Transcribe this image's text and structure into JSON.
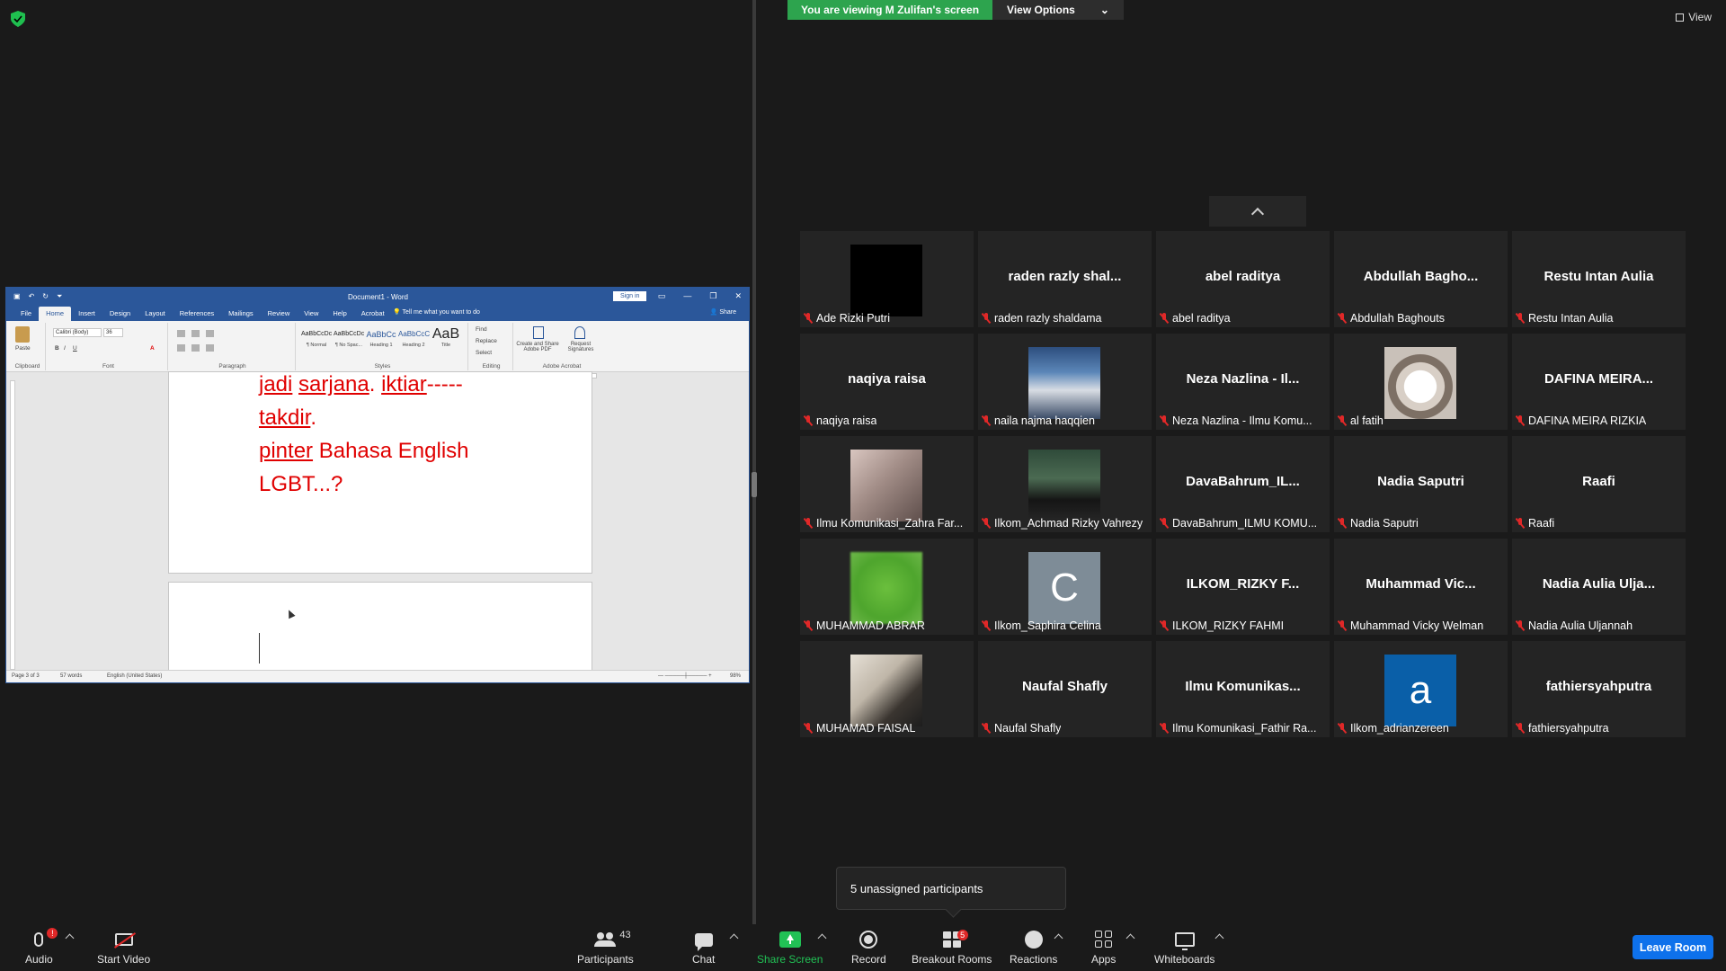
{
  "colors": {
    "accent": "#0e71eb",
    "green": "#2da44e",
    "muted_red": "#e02828",
    "word_blue": "#2b579a",
    "doc_text_red": "#e00000"
  },
  "banner": {
    "viewing": "You are viewing M Zulifan's screen",
    "view_options": "View Options"
  },
  "view_button": {
    "label": "View",
    "icon": "grid-view-icon"
  },
  "word": {
    "title": "Document1  -  Word",
    "sign_in": "Sign in",
    "tabs": [
      "File",
      "Home",
      "Insert",
      "Design",
      "Layout",
      "References",
      "Mailings",
      "Review",
      "View",
      "Help",
      "Acrobat"
    ],
    "tell_me": "Tell me what you want to do",
    "share": "Share",
    "ribbon": {
      "paste": "Paste",
      "font_name": "Calibri (Body)",
      "font_size": "36",
      "styles": [
        {
          "preview": "AaBbCcDc",
          "name": "¶ Normal"
        },
        {
          "preview": "AaBbCcDc",
          "name": "¶ No Spac..."
        },
        {
          "preview": "AaBbCc",
          "name": "Heading 1"
        },
        {
          "preview": "AaBbCcC",
          "name": "Heading 2"
        },
        {
          "preview": "AaB",
          "name": "Title"
        }
      ],
      "find": "Find",
      "replace": "Replace",
      "select": "Select",
      "create_pdf": "Create and Share Adobe PDF",
      "request_sig": "Request Signatures",
      "groups": {
        "clipboard": "Clipboard",
        "font": "Font",
        "paragraph": "Paragraph",
        "styles": "Styles",
        "editing": "Editing",
        "acrobat": "Adobe Acrobat"
      }
    },
    "document_lines": {
      "line1": {
        "a": "jadi",
        "b": "sarjana",
        "c": ". ",
        "d": "iktiar",
        "e": "-----"
      },
      "line2": {
        "a": "takdir",
        "b": "."
      },
      "line3": {
        "a": "pinter",
        "b": " Bahasa English"
      },
      "line4": "LGBT...?"
    },
    "status": {
      "page": "Page 3 of 3",
      "words": "57 words",
      "language": "English (United States)",
      "zoom": "98%"
    }
  },
  "participants_tiles": [
    {
      "big": "",
      "name": "Ade Rizki Putri",
      "avatar": "black"
    },
    {
      "big": "raden  razly  shal...",
      "name": "raden razly shaldama",
      "avatar": ""
    },
    {
      "big": "abel raditya",
      "name": "abel raditya",
      "avatar": ""
    },
    {
      "big": "Abdullah  Bagho...",
      "name": "Abdullah Baghouts",
      "avatar": ""
    },
    {
      "big": "Restu Intan Aulia",
      "name": "Restu Intan Aulia",
      "avatar": ""
    },
    {
      "big": "naqiya raisa",
      "name": "naqiya raisa",
      "avatar": ""
    },
    {
      "big": "",
      "name": "naila najma haqqien",
      "avatar": "sky"
    },
    {
      "big": "Neza Nazlina - Il...",
      "name": "Neza Nazlina - Ilmu Komu...",
      "avatar": ""
    },
    {
      "big": "",
      "name": "al fatih",
      "avatar": "cat"
    },
    {
      "big": "DAFINA MEIRA...",
      "name": "DAFINA MEIRA RIZKIA",
      "avatar": ""
    },
    {
      "big": "",
      "name": "Ilmu Komunikasi_Zahra Far...",
      "avatar": "girl"
    },
    {
      "big": "",
      "name": "Ilkom_Achmad Rizky Vahrezy",
      "avatar": "man1"
    },
    {
      "big": "DavaBahrum_IL...",
      "name": "DavaBahrum_ILMU KOMU...",
      "avatar": ""
    },
    {
      "big": "Nadia Saputri",
      "name": "Nadia Saputri",
      "avatar": ""
    },
    {
      "big": "Raafi",
      "name": "Raafi",
      "avatar": ""
    },
    {
      "big": "",
      "name": "MUHAMMAD ABRAR",
      "avatar": "green"
    },
    {
      "big": "",
      "name": "Ilkom_Saphira Celina",
      "avatar": "letter-c",
      "letter": "C"
    },
    {
      "big": "ILKOM_RIZKY F...",
      "name": "ILKOM_RIZKY FAHMI",
      "avatar": ""
    },
    {
      "big": "Muhammad  Vic...",
      "name": "Muhammad Vicky Welman",
      "avatar": ""
    },
    {
      "big": "Nadia Aulia Ulja...",
      "name": "Nadia Aulia Uljannah",
      "avatar": ""
    },
    {
      "big": "",
      "name": "MUHAMAD FAISAL",
      "avatar": "man2"
    },
    {
      "big": "Naufal Shafly",
      "name": "Naufal Shafly",
      "avatar": ""
    },
    {
      "big": "Ilmu  Komunikas...",
      "name": "Ilmu Komunikasi_Fathir Ra...",
      "avatar": ""
    },
    {
      "big": "",
      "name": "Ilkom_adrianzereen",
      "avatar": "letter-a",
      "letter": "a"
    },
    {
      "big": "fathiersyahputra",
      "name": "fathiersyahputra",
      "avatar": ""
    }
  ],
  "unassigned": "5 unassigned participants",
  "toolbar": {
    "audio": "Audio",
    "audio_badge": "!",
    "start_video": "Start Video",
    "participants": "Participants",
    "participants_count": "43",
    "chat": "Chat",
    "share_screen": "Share Screen",
    "record": "Record",
    "breakout_rooms": "Breakout Rooms",
    "breakout_badge": "5",
    "reactions": "Reactions",
    "apps": "Apps",
    "whiteboards": "Whiteboards",
    "leave": "Leave Room"
  }
}
